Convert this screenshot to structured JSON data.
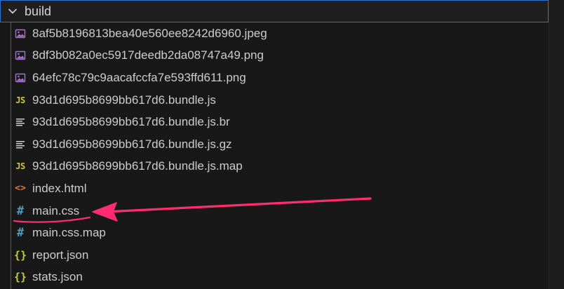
{
  "folder": {
    "name": "build",
    "expanded": true
  },
  "files": [
    {
      "name": "8af5b8196813bea40e560ee8242d6960.jpeg",
      "icon": "image-file-icon"
    },
    {
      "name": "8df3b082a0ec5917deedb2da08747a49.png",
      "icon": "image-file-icon"
    },
    {
      "name": "64efc78c79c9aacafccfa7e593ffd611.png",
      "icon": "image-file-icon"
    },
    {
      "name": "93d1d695b8699bb617d6.bundle.js",
      "icon": "js-file-icon",
      "icon_text": "JS"
    },
    {
      "name": "93d1d695b8699bb617d6.bundle.js.br",
      "icon": "text-file-icon"
    },
    {
      "name": "93d1d695b8699bb617d6.bundle.js.gz",
      "icon": "text-file-icon"
    },
    {
      "name": "93d1d695b8699bb617d6.bundle.js.map",
      "icon": "js-file-icon",
      "icon_text": "JS"
    },
    {
      "name": "index.html",
      "icon": "html-file-icon",
      "icon_text": "<>"
    },
    {
      "name": "main.css",
      "icon": "css-file-icon",
      "icon_text": "#"
    },
    {
      "name": "main.css.map",
      "icon": "css-file-icon",
      "icon_text": "#"
    },
    {
      "name": "report.json",
      "icon": "json-file-icon",
      "icon_text": "{}"
    },
    {
      "name": "stats.json",
      "icon": "json-file-icon",
      "icon_text": "{}"
    }
  ],
  "colors": {
    "background": "#181818",
    "focus_border": "#2f6fd0",
    "text": "#cccccc",
    "image_icon": "#a074c4",
    "js_icon": "#cbcb41",
    "html_icon": "#e37933",
    "css_icon": "#519aba",
    "json_icon": "#cbcb41",
    "annotation_arrow": "#ff2d6f"
  },
  "annotation": {
    "type": "arrow-with-underline",
    "target": "main.css"
  }
}
